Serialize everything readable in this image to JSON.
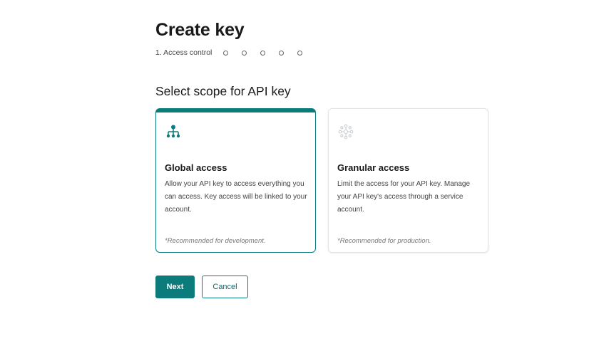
{
  "page": {
    "title": "Create key"
  },
  "stepper": {
    "current_label": "1. Access control",
    "remaining_steps": 5
  },
  "scope": {
    "section_title": "Select scope for API key",
    "options": [
      {
        "title": "Global access",
        "description": "Allow your API key to access everything you can access. Key access will be linked to your account.",
        "note": "*Recommended for development.",
        "icon": "hierarchy-icon",
        "selected": true
      },
      {
        "title": "Granular access",
        "description": "Limit the access for your API key. Manage your API key's access through a service account.",
        "note": "*Recommended for production.",
        "icon": "granular-network-icon",
        "selected": false
      }
    ]
  },
  "actions": {
    "next_label": "Next",
    "cancel_label": "Cancel"
  },
  "colors": {
    "accent": "#0b7b7b",
    "inactive_icon": "#c9cfd3"
  }
}
